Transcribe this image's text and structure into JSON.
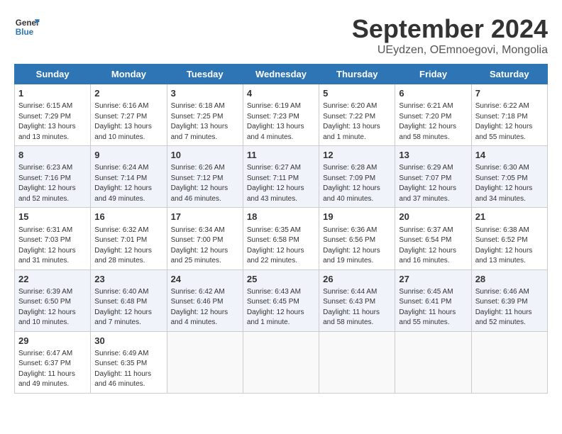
{
  "header": {
    "logo_line1": "General",
    "logo_line2": "Blue",
    "month": "September 2024",
    "location": "UEydzen, OEmnoegovi, Mongolia"
  },
  "weekdays": [
    "Sunday",
    "Monday",
    "Tuesday",
    "Wednesday",
    "Thursday",
    "Friday",
    "Saturday"
  ],
  "weeks": [
    [
      {
        "day": "1",
        "info": "Sunrise: 6:15 AM\nSunset: 7:29 PM\nDaylight: 13 hours\nand 13 minutes."
      },
      {
        "day": "2",
        "info": "Sunrise: 6:16 AM\nSunset: 7:27 PM\nDaylight: 13 hours\nand 10 minutes."
      },
      {
        "day": "3",
        "info": "Sunrise: 6:18 AM\nSunset: 7:25 PM\nDaylight: 13 hours\nand 7 minutes."
      },
      {
        "day": "4",
        "info": "Sunrise: 6:19 AM\nSunset: 7:23 PM\nDaylight: 13 hours\nand 4 minutes."
      },
      {
        "day": "5",
        "info": "Sunrise: 6:20 AM\nSunset: 7:22 PM\nDaylight: 13 hours\nand 1 minute."
      },
      {
        "day": "6",
        "info": "Sunrise: 6:21 AM\nSunset: 7:20 PM\nDaylight: 12 hours\nand 58 minutes."
      },
      {
        "day": "7",
        "info": "Sunrise: 6:22 AM\nSunset: 7:18 PM\nDaylight: 12 hours\nand 55 minutes."
      }
    ],
    [
      {
        "day": "8",
        "info": "Sunrise: 6:23 AM\nSunset: 7:16 PM\nDaylight: 12 hours\nand 52 minutes."
      },
      {
        "day": "9",
        "info": "Sunrise: 6:24 AM\nSunset: 7:14 PM\nDaylight: 12 hours\nand 49 minutes."
      },
      {
        "day": "10",
        "info": "Sunrise: 6:26 AM\nSunset: 7:12 PM\nDaylight: 12 hours\nand 46 minutes."
      },
      {
        "day": "11",
        "info": "Sunrise: 6:27 AM\nSunset: 7:11 PM\nDaylight: 12 hours\nand 43 minutes."
      },
      {
        "day": "12",
        "info": "Sunrise: 6:28 AM\nSunset: 7:09 PM\nDaylight: 12 hours\nand 40 minutes."
      },
      {
        "day": "13",
        "info": "Sunrise: 6:29 AM\nSunset: 7:07 PM\nDaylight: 12 hours\nand 37 minutes."
      },
      {
        "day": "14",
        "info": "Sunrise: 6:30 AM\nSunset: 7:05 PM\nDaylight: 12 hours\nand 34 minutes."
      }
    ],
    [
      {
        "day": "15",
        "info": "Sunrise: 6:31 AM\nSunset: 7:03 PM\nDaylight: 12 hours\nand 31 minutes."
      },
      {
        "day": "16",
        "info": "Sunrise: 6:32 AM\nSunset: 7:01 PM\nDaylight: 12 hours\nand 28 minutes."
      },
      {
        "day": "17",
        "info": "Sunrise: 6:34 AM\nSunset: 7:00 PM\nDaylight: 12 hours\nand 25 minutes."
      },
      {
        "day": "18",
        "info": "Sunrise: 6:35 AM\nSunset: 6:58 PM\nDaylight: 12 hours\nand 22 minutes."
      },
      {
        "day": "19",
        "info": "Sunrise: 6:36 AM\nSunset: 6:56 PM\nDaylight: 12 hours\nand 19 minutes."
      },
      {
        "day": "20",
        "info": "Sunrise: 6:37 AM\nSunset: 6:54 PM\nDaylight: 12 hours\nand 16 minutes."
      },
      {
        "day": "21",
        "info": "Sunrise: 6:38 AM\nSunset: 6:52 PM\nDaylight: 12 hours\nand 13 minutes."
      }
    ],
    [
      {
        "day": "22",
        "info": "Sunrise: 6:39 AM\nSunset: 6:50 PM\nDaylight: 12 hours\nand 10 minutes."
      },
      {
        "day": "23",
        "info": "Sunrise: 6:40 AM\nSunset: 6:48 PM\nDaylight: 12 hours\nand 7 minutes."
      },
      {
        "day": "24",
        "info": "Sunrise: 6:42 AM\nSunset: 6:46 PM\nDaylight: 12 hours\nand 4 minutes."
      },
      {
        "day": "25",
        "info": "Sunrise: 6:43 AM\nSunset: 6:45 PM\nDaylight: 12 hours\nand 1 minute."
      },
      {
        "day": "26",
        "info": "Sunrise: 6:44 AM\nSunset: 6:43 PM\nDaylight: 11 hours\nand 58 minutes."
      },
      {
        "day": "27",
        "info": "Sunrise: 6:45 AM\nSunset: 6:41 PM\nDaylight: 11 hours\nand 55 minutes."
      },
      {
        "day": "28",
        "info": "Sunrise: 6:46 AM\nSunset: 6:39 PM\nDaylight: 11 hours\nand 52 minutes."
      }
    ],
    [
      {
        "day": "29",
        "info": "Sunrise: 6:47 AM\nSunset: 6:37 PM\nDaylight: 11 hours\nand 49 minutes."
      },
      {
        "day": "30",
        "info": "Sunrise: 6:49 AM\nSunset: 6:35 PM\nDaylight: 11 hours\nand 46 minutes."
      },
      {
        "day": "",
        "info": ""
      },
      {
        "day": "",
        "info": ""
      },
      {
        "day": "",
        "info": ""
      },
      {
        "day": "",
        "info": ""
      },
      {
        "day": "",
        "info": ""
      }
    ]
  ]
}
